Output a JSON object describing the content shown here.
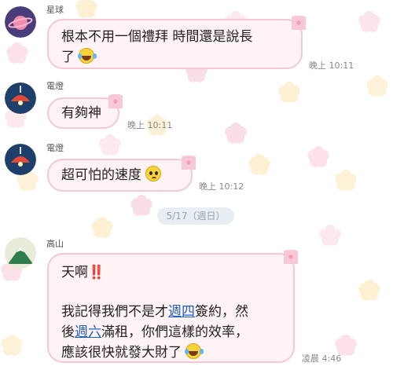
{
  "messages": [
    {
      "sender": "星球",
      "lines": [
        "根本不用一個禮拜 時間還是說長",
        "了"
      ],
      "emoji": "grinning-squinting-tears-emoji",
      "time": "晚上 10:11"
    },
    {
      "sender": "電燈",
      "text": "有夠神",
      "time": "晚上 10:11"
    },
    {
      "sender": "電燈",
      "text": "超可怕的速度",
      "emoji": "holding-back-tears-emoji",
      "time": "晚上 10:12"
    },
    {
      "sender": "高山",
      "line1": "天啊",
      "line1_bang": "‼️",
      "line2a": "我記得我們不是才",
      "line2_link": "週四",
      "line2b": "簽約，然",
      "line3a": "後",
      "line3_link": "週六",
      "line3b": "滿租，你們這樣的效率，",
      "line4": "應該很快就發大財了",
      "emoji": "grinning-squinting-tears-emoji",
      "time": "凌晨 4:46"
    }
  ],
  "date_separator": "5/17（週日）",
  "colors": {
    "bubble_bg": "#fff3f6",
    "bubble_border": "#f3c8d3",
    "link": "#1f5fbf",
    "date_pill": "#e9eef2"
  }
}
